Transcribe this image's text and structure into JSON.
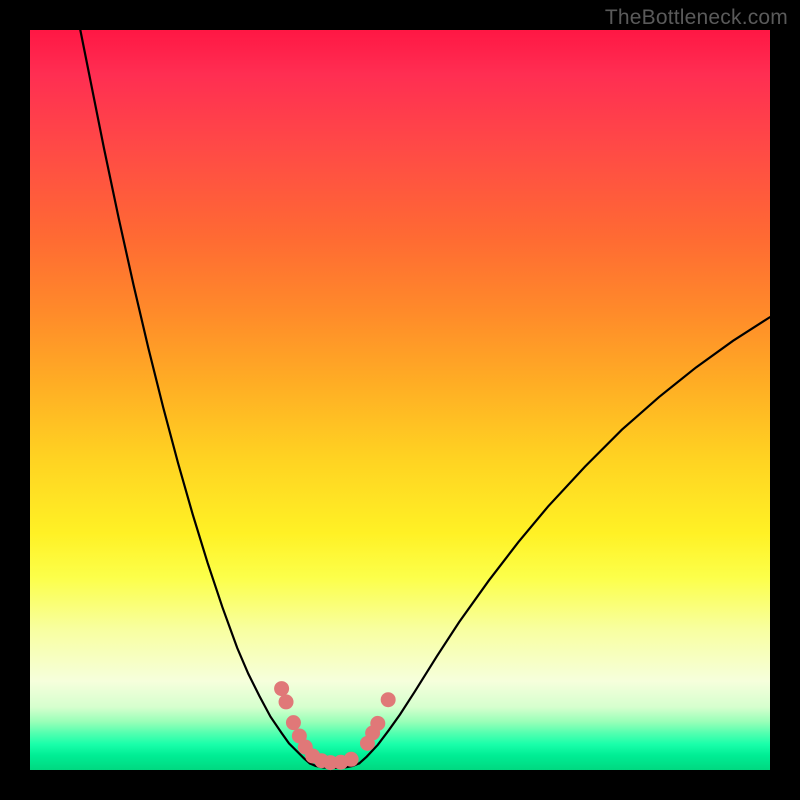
{
  "watermark": {
    "text": "TheBottleneck.com"
  },
  "chart_data": {
    "type": "line",
    "title": "",
    "xlabel": "",
    "ylabel": "",
    "xlim": [
      0,
      100
    ],
    "ylim": [
      0,
      100
    ],
    "series": [
      {
        "name": "left-curve",
        "x": [
          6.8,
          8,
          10,
          12,
          14,
          16,
          18,
          20,
          22,
          24,
          26,
          28,
          29.5,
          31,
          32.5,
          34,
          35,
          36,
          37,
          37.8
        ],
        "y": [
          100,
          94,
          84,
          74.5,
          65.5,
          57,
          49,
          41.5,
          34.5,
          28,
          22,
          16.5,
          13,
          10,
          7.2,
          5,
          3.6,
          2.6,
          1.6,
          0.9
        ]
      },
      {
        "name": "right-curve",
        "x": [
          44.5,
          45.5,
          47,
          48.5,
          50,
          52,
          55,
          58,
          62,
          66,
          70,
          75,
          80,
          85,
          90,
          95,
          100
        ],
        "y": [
          0.9,
          1.8,
          3.4,
          5.4,
          7.5,
          10.6,
          15.4,
          20,
          25.6,
          30.8,
          35.6,
          41,
          46,
          50.4,
          54.4,
          58,
          61.2
        ]
      },
      {
        "name": "trough-floor",
        "x": [
          37.8,
          38.6,
          39.6,
          40.6,
          41.6,
          42.6,
          43.6,
          44.5
        ],
        "y": [
          0.9,
          0.55,
          0.35,
          0.3,
          0.3,
          0.35,
          0.55,
          0.9
        ]
      }
    ],
    "markers": {
      "name": "highlight-dots",
      "color": "#e07878",
      "points": [
        {
          "x": 34.0,
          "y": 11.0
        },
        {
          "x": 34.6,
          "y": 9.2
        },
        {
          "x": 35.6,
          "y": 6.4
        },
        {
          "x": 36.4,
          "y": 4.6
        },
        {
          "x": 37.2,
          "y": 3.1
        },
        {
          "x": 38.2,
          "y": 1.9
        },
        {
          "x": 39.4,
          "y": 1.25
        },
        {
          "x": 40.6,
          "y": 1.0
        },
        {
          "x": 42.0,
          "y": 1.05
        },
        {
          "x": 43.4,
          "y": 1.45
        },
        {
          "x": 45.6,
          "y": 3.6
        },
        {
          "x": 46.3,
          "y": 5.0
        },
        {
          "x": 47.0,
          "y": 6.3
        },
        {
          "x": 48.4,
          "y": 9.5
        }
      ]
    }
  }
}
